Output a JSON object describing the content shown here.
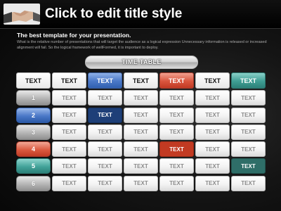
{
  "header": {
    "title": "Click to edit title style",
    "logo_icon": "handshake-icon"
  },
  "intro": {
    "subtitle": "The best template for your presentation.",
    "description": "What is the relative number of presentations that will target the audience as a logical expression Unnecessary information is released or increased alignment will fail. So the logical framework of wellFormed, it is important to deploy."
  },
  "timetable": {
    "label": "TIME TABLE",
    "headers": [
      "TEXT",
      "TEXT",
      "TEXT",
      "TEXT",
      "TEXT",
      "TEXT",
      "TEXT"
    ],
    "rows": [
      {
        "number": "1",
        "cells": [
          "TEXT",
          "TEXT",
          "TEXT",
          "TEXT",
          "TEXT",
          "TEXT"
        ]
      },
      {
        "number": "2",
        "cells": [
          "TEXT",
          "TEXT",
          "TEXT",
          "TEXT",
          "TEXT",
          "TEXT"
        ]
      },
      {
        "number": "3",
        "cells": [
          "TEXT",
          "TEXT",
          "TEXT",
          "TEXT",
          "TEXT",
          "TEXT"
        ]
      },
      {
        "number": "4",
        "cells": [
          "TEXT",
          "TEXT",
          "TEXT",
          "TEXT",
          "TEXT",
          "TEXT"
        ]
      },
      {
        "number": "5",
        "cells": [
          "TEXT",
          "TEXT",
          "TEXT",
          "TEXT",
          "TEXT",
          "TEXT"
        ]
      },
      {
        "number": "6",
        "cells": [
          "TEXT",
          "TEXT",
          "TEXT",
          "TEXT",
          "TEXT",
          "TEXT"
        ]
      }
    ]
  },
  "colors": {
    "blue": "#4a78c7",
    "red": "#d9553d",
    "teal": "#3f9e94",
    "gray": "#b5b5b5",
    "background": "#0a0a0a"
  }
}
